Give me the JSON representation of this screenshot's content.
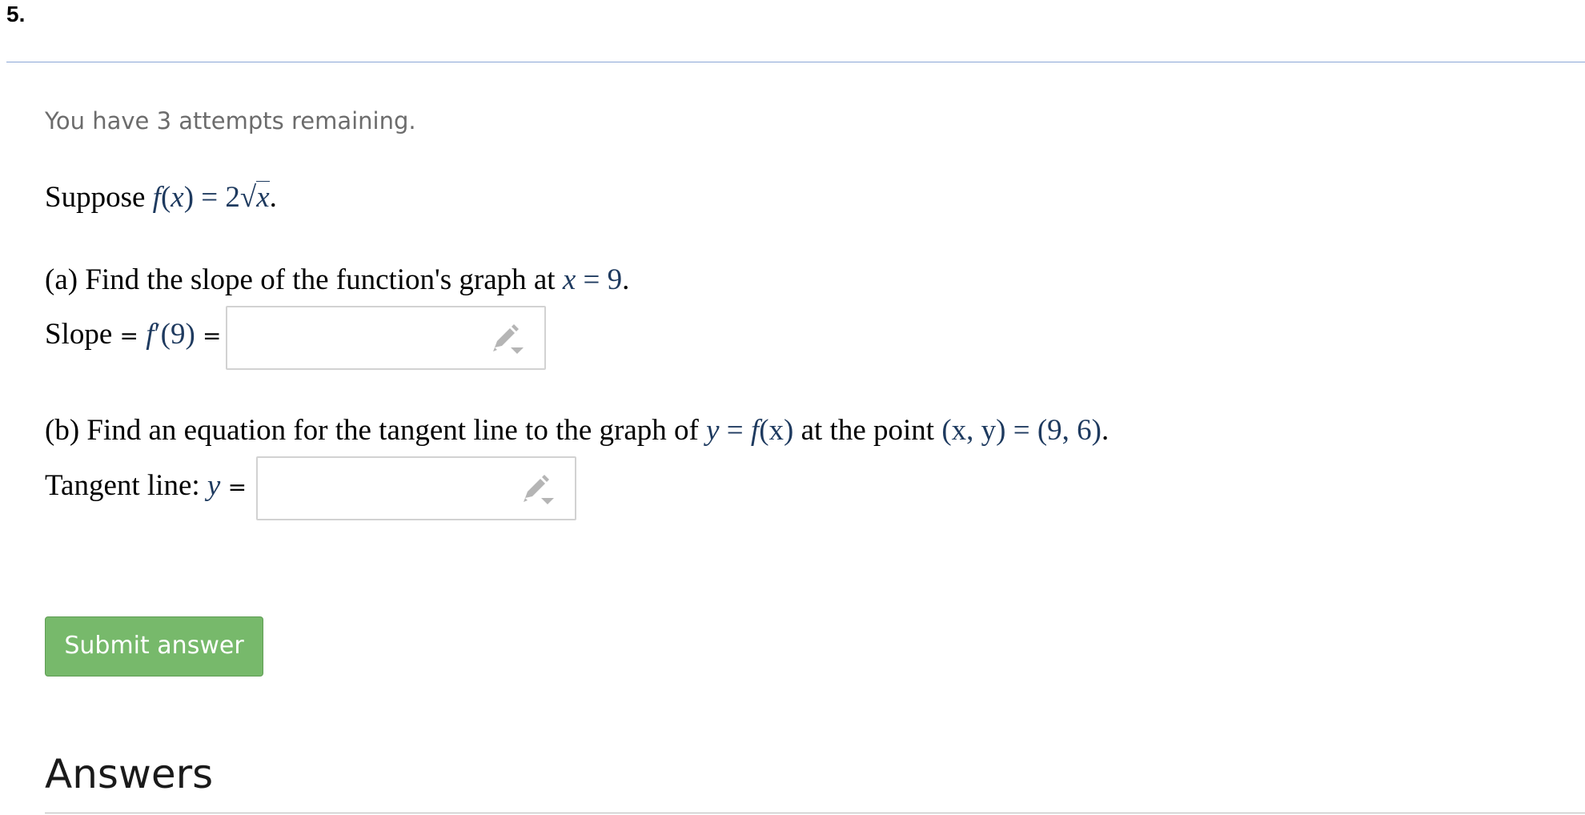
{
  "question": {
    "number": "5.",
    "attempts_text": "You have 3 attempts remaining."
  },
  "problem": {
    "suppose_word": "Suppose",
    "f": "f",
    "lparen": "(",
    "x": "x",
    "rparen": ")",
    "equals": " = ",
    "coef": "2",
    "radical": "√",
    "radicand": "x",
    "period": "."
  },
  "part_a": {
    "prompt": "(a) Find the slope of the function's graph at ",
    "var": "x",
    "equals": " = ",
    "value": "9",
    "period": ".",
    "label_prefix": "Slope ",
    "label_eq": "=",
    "math_f": "f",
    "math_prime": "′",
    "math_arg": "(9)",
    "label_suffix_eq": "="
  },
  "part_b": {
    "prompt": "(b) Find an equation for the tangent line to the graph of ",
    "y": "y",
    "equals": " = ",
    "f": "f",
    "fx": "(x)",
    "at_point": " at the point ",
    "point_lhs": "(x, y)",
    "point_equals": " = ",
    "point_rhs": "(9, 6)",
    "period": ".",
    "label_prefix": "Tangent line: ",
    "label_y": "y",
    "label_eq": "="
  },
  "input_a": {
    "value": ""
  },
  "input_b": {
    "value": ""
  },
  "submit": {
    "label": "Submit answer"
  },
  "answers": {
    "heading": "Answers"
  },
  "icons": {
    "answer_input_icon": "pencil-dropdown-icon"
  },
  "colors": {
    "math": "#1e3a5f",
    "submit_bg": "#77b96b",
    "rule_top": "#8aa6d6",
    "attempts_text": "#6c6c6c"
  }
}
